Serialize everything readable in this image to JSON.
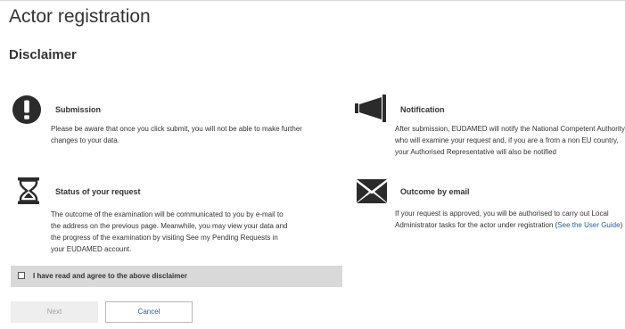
{
  "page": {
    "title": "Actor registration",
    "section_title": "Disclaimer"
  },
  "blocks": {
    "submission": {
      "icon": "exclamation-circle-icon",
      "title": "Submission",
      "text": "Please be aware that once you click submit, you will not be able to make further changes to your data."
    },
    "notification": {
      "icon": "megaphone-icon",
      "title": "Notification",
      "text": "After submission, EUDAMED will notify the National Competent Authority who will examine your request and, if you are a from a non EU country, your Authorised Representative will also be notified"
    },
    "status": {
      "icon": "hourglass-icon",
      "title": "Status of your request",
      "text": "The outcome of the examination will be communicated to you by e-mail to the address on the previous page. Meanwhile, you may view your data and the progress of the examination by visiting See my Pending Requests in your EUDAMED account."
    },
    "outcome": {
      "icon": "envelope-icon",
      "title": "Outcome by email",
      "text_before": "If your request is approved, you will be authorised to carry out Local Administrator tasks for the actor under registration (",
      "link": "See the User Guide",
      "text_after": ")"
    }
  },
  "agreement": {
    "checked": false,
    "label": "I have read and agree to the above disclaimer"
  },
  "buttons": {
    "next": "Next",
    "cancel": "Cancel"
  },
  "colors": {
    "link": "#1f5fa8",
    "checkbox_bar": "#d9d9d9",
    "icon": "#2b2b2b"
  }
}
